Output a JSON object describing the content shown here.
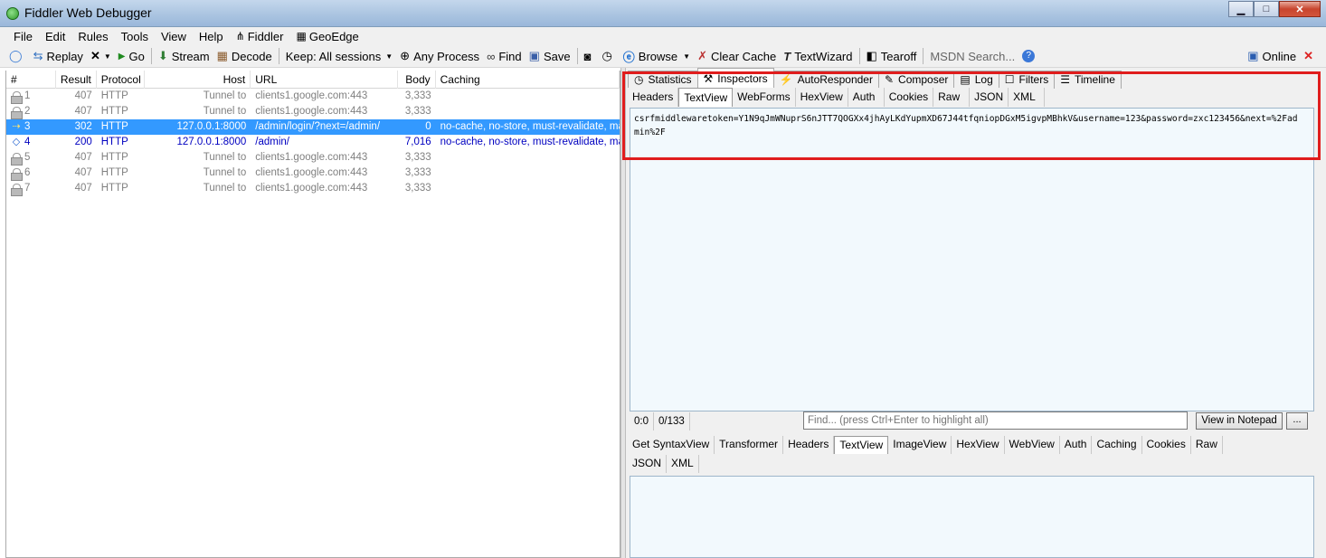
{
  "window": {
    "title": "Fiddler Web Debugger"
  },
  "menu": [
    {
      "label": "File"
    },
    {
      "label": "Edit"
    },
    {
      "label": "Rules"
    },
    {
      "label": "Tools"
    },
    {
      "label": "View"
    },
    {
      "label": "Help"
    },
    {
      "label": "Fiddler",
      "icon": "fiddler-icon"
    },
    {
      "label": "GeoEdge",
      "icon": "geoedge-icon"
    }
  ],
  "toolbar": {
    "replay": "Replay",
    "go": "Go",
    "stream": "Stream",
    "decode": "Decode",
    "keep": "Keep: All sessions",
    "process": "Any Process",
    "find": "Find",
    "save": "Save",
    "browse": "Browse",
    "clear_cache": "Clear Cache",
    "textwizard": "TextWizard",
    "tearoff": "Tearoff",
    "msdn_search": "MSDN Search...",
    "online": "Online"
  },
  "sessions": {
    "columns": [
      "#",
      "Result",
      "Protocol",
      "Host",
      "URL",
      "Body",
      "Caching"
    ],
    "rows": [
      {
        "num": "1",
        "result": "407",
        "protocol": "HTTP",
        "host": "Tunnel to",
        "url": "clients1.google.com:443",
        "body": "3,333",
        "caching": "",
        "style": "normal",
        "icon": "lock-icon"
      },
      {
        "num": "2",
        "result": "407",
        "protocol": "HTTP",
        "host": "Tunnel to",
        "url": "clients1.google.com:443",
        "body": "3,333",
        "caching": "",
        "style": "normal",
        "icon": "lock-icon"
      },
      {
        "num": "3",
        "result": "302",
        "protocol": "HTTP",
        "host": "127.0.0.1:8000",
        "url": "/admin/login/?next=/admin/",
        "body": "0",
        "caching": "no-cache, no-store, must-revalidate, ma...",
        "style": "selected",
        "icon": "redirect-icon"
      },
      {
        "num": "4",
        "result": "200",
        "protocol": "HTTP",
        "host": "127.0.0.1:8000",
        "url": "/admin/",
        "body": "7,016",
        "caching": "no-cache, no-store, must-revalidate, ma...",
        "style": "blue",
        "icon": "html-icon"
      },
      {
        "num": "5",
        "result": "407",
        "protocol": "HTTP",
        "host": "Tunnel to",
        "url": "clients1.google.com:443",
        "body": "3,333",
        "caching": "",
        "style": "normal",
        "icon": "lock-icon"
      },
      {
        "num": "6",
        "result": "407",
        "protocol": "HTTP",
        "host": "Tunnel to",
        "url": "clients1.google.com:443",
        "body": "3,333",
        "caching": "",
        "style": "normal",
        "icon": "lock-icon"
      },
      {
        "num": "7",
        "result": "407",
        "protocol": "HTTP",
        "host": "Tunnel to",
        "url": "clients1.google.com:443",
        "body": "3,333",
        "caching": "",
        "style": "normal",
        "icon": "lock-icon"
      }
    ]
  },
  "main_tabs": [
    {
      "label": "Statistics",
      "icon": "stopwatch-icon"
    },
    {
      "label": "Inspectors",
      "icon": "inspectors-icon",
      "active": true
    },
    {
      "label": "AutoResponder",
      "icon": "lightning-icon"
    },
    {
      "label": "Composer",
      "icon": "composer-icon"
    },
    {
      "label": "Log",
      "icon": "log-icon"
    },
    {
      "label": "Filters",
      "icon": "checkbox-icon"
    },
    {
      "label": "Timeline",
      "icon": "timeline-icon"
    }
  ],
  "request_tabs": [
    "Headers",
    "TextView",
    "WebForms",
    "HexView",
    "Auth",
    "Cookies",
    "Raw",
    "JSON",
    "XML"
  ],
  "request_active": "TextView",
  "request_body": "csrfmiddlewaretoken=Y1N9qJmWNuprS6nJTT7QOGXx4jhAyLKdYupmXD67J44tfqniopDGxM5igvpMBhkV&username=123&password=zxc123456&next=%2Fadmin%2F",
  "status": {
    "position": "0:0",
    "count": "0/133",
    "find_placeholder": "Find... (press Ctrl+Enter to highlight all)",
    "view_notepad": "View in Notepad",
    "more": "..."
  },
  "response_tabs_row1": [
    "Get SyntaxView",
    "Transformer",
    "Headers",
    "TextView",
    "ImageView",
    "HexView",
    "WebView",
    "Auth",
    "Caching",
    "Cookies",
    "Raw"
  ],
  "response_tabs_row2": [
    "JSON",
    "XML"
  ],
  "response_active": "TextView"
}
